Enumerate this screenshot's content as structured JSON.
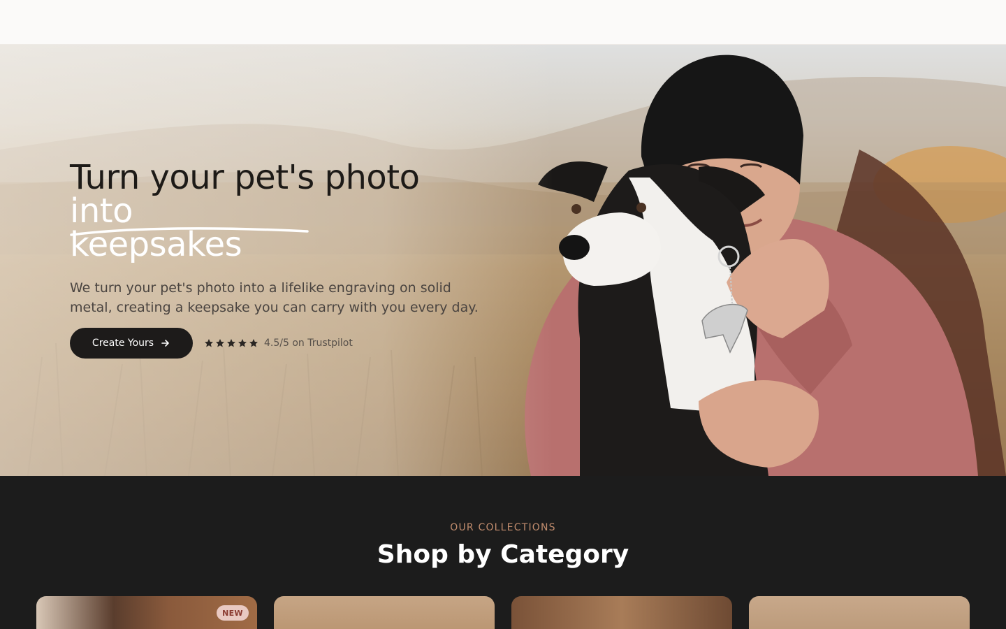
{
  "hero": {
    "headline_line1": "Turn your pet's photo",
    "headline_line2": "into keepsakes",
    "subtext": "We turn your pet's photo into a lifelike engraving on solid metal, creating a keepsake you can carry with you every day.",
    "cta_label": "Create Yours",
    "cta_icon": "arrow-right-icon",
    "rating_icon": "star-icon",
    "rating_text": "4.5/5 on Trustpilot",
    "rating_stars": 5
  },
  "collections": {
    "eyebrow": "OUR COLLECTIONS",
    "title": "Shop by Category",
    "cards": [
      {
        "badge": "NEW"
      },
      {
        "badge": ""
      },
      {
        "badge": ""
      },
      {
        "badge": ""
      }
    ]
  },
  "colors": {
    "cta_background": "#1d1b1a",
    "dark_section": "#1c1c1c",
    "eyebrow_accent": "#c28d6e",
    "badge_background": "#e9c9c2"
  }
}
